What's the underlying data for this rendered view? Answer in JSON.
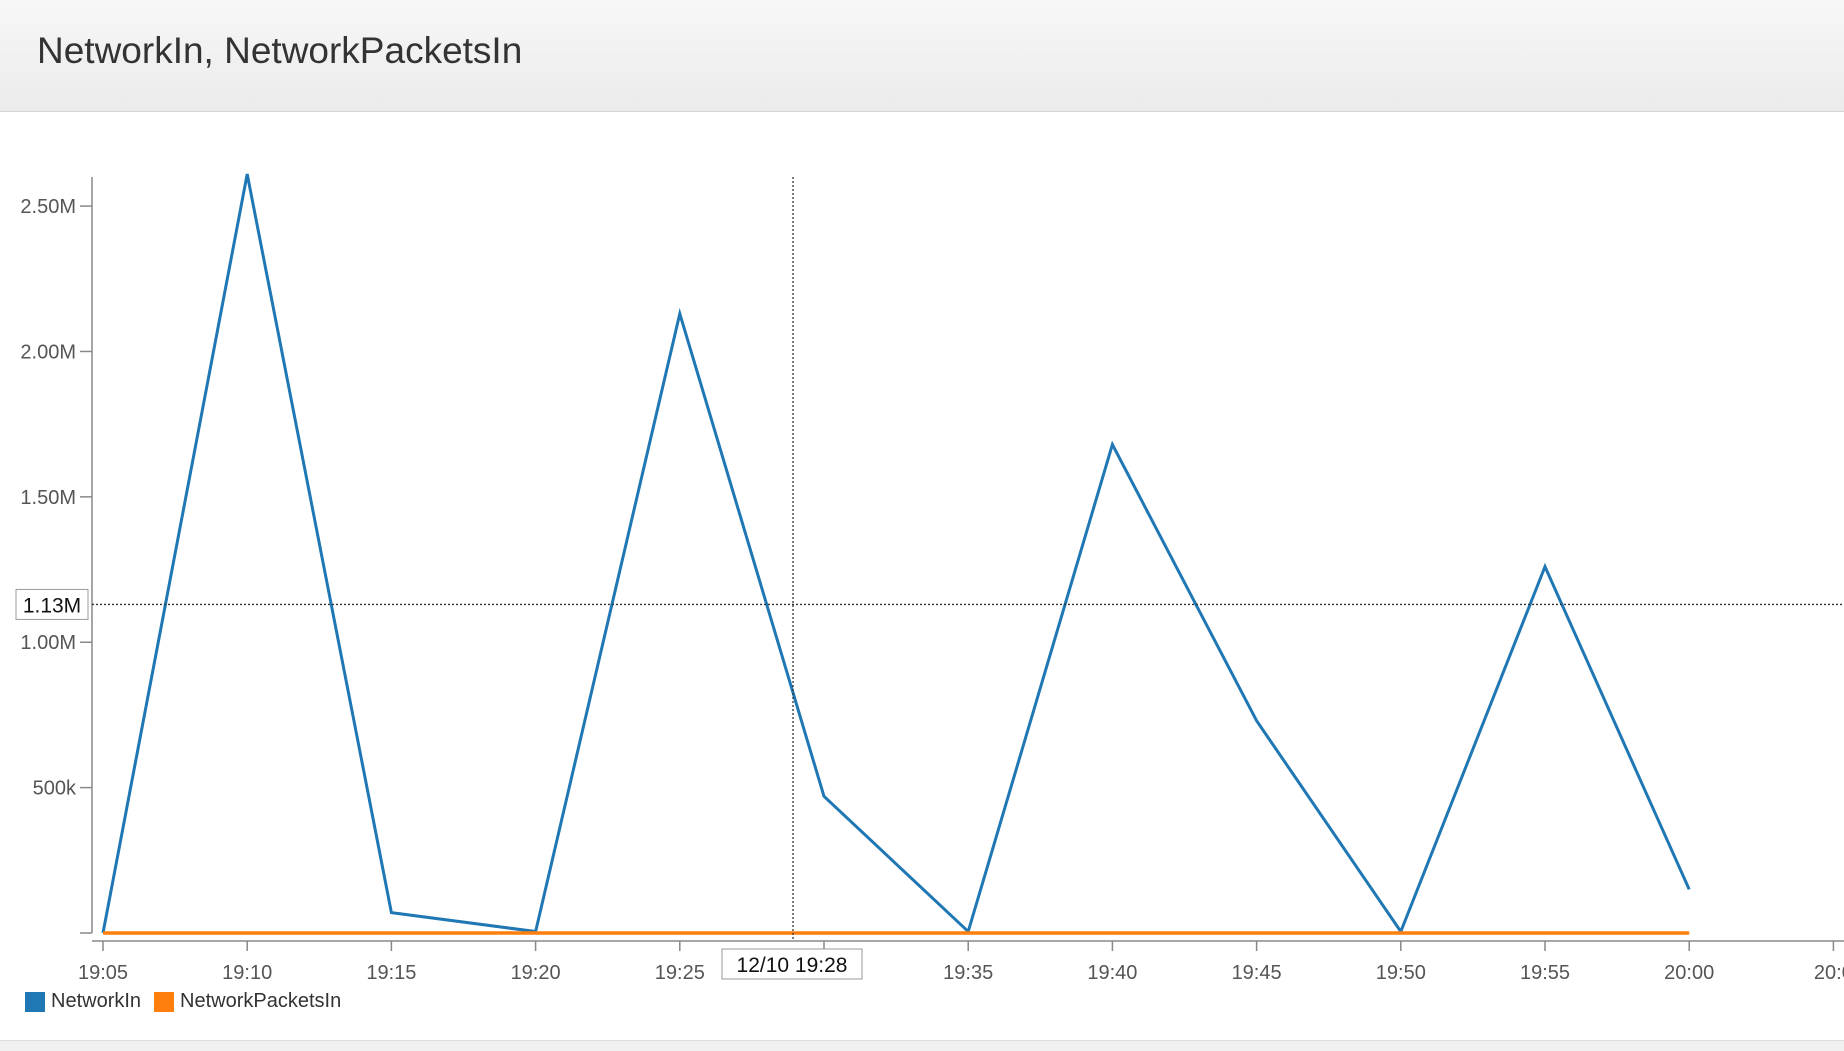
{
  "panel": {
    "title": "NetworkIn, NetworkPacketsIn"
  },
  "colors": {
    "networkin": "#1f77b4",
    "networkpacketsin": "#ff7f0e",
    "axis": "#888888",
    "crosshair": "#333333"
  },
  "chart_data": {
    "type": "line",
    "x": [
      "19:05",
      "19:10",
      "19:15",
      "19:20",
      "19:25",
      "19:30",
      "19:35",
      "19:40",
      "19:45",
      "19:50",
      "19:55",
      "20:00"
    ],
    "x_tick_labels": [
      "19:05",
      "19:10",
      "19:15",
      "19:20",
      "19:25",
      "19:35",
      "19:40",
      "19:45",
      "19:50",
      "19:55",
      "20:00",
      "20:0"
    ],
    "y_tick_labels": [
      "2.50M",
      "2.00M",
      "1.50M",
      "1.00M",
      "500k"
    ],
    "ylim": [
      0,
      2600000
    ],
    "grid": false,
    "legend_position": "bottom-left",
    "series": [
      {
        "name": "NetworkIn",
        "values": [
          0,
          2610000,
          70000,
          5000,
          2130000,
          470000,
          5000,
          1680000,
          730000,
          5000,
          1260000,
          150000
        ]
      },
      {
        "name": "NetworkPacketsIn",
        "values": [
          0,
          0,
          0,
          0,
          0,
          0,
          0,
          0,
          0,
          0,
          0,
          0
        ]
      }
    ],
    "crosshair": {
      "x_label": "12/10 19:28",
      "y_label": "1.13M",
      "y_value": 1130000
    }
  }
}
